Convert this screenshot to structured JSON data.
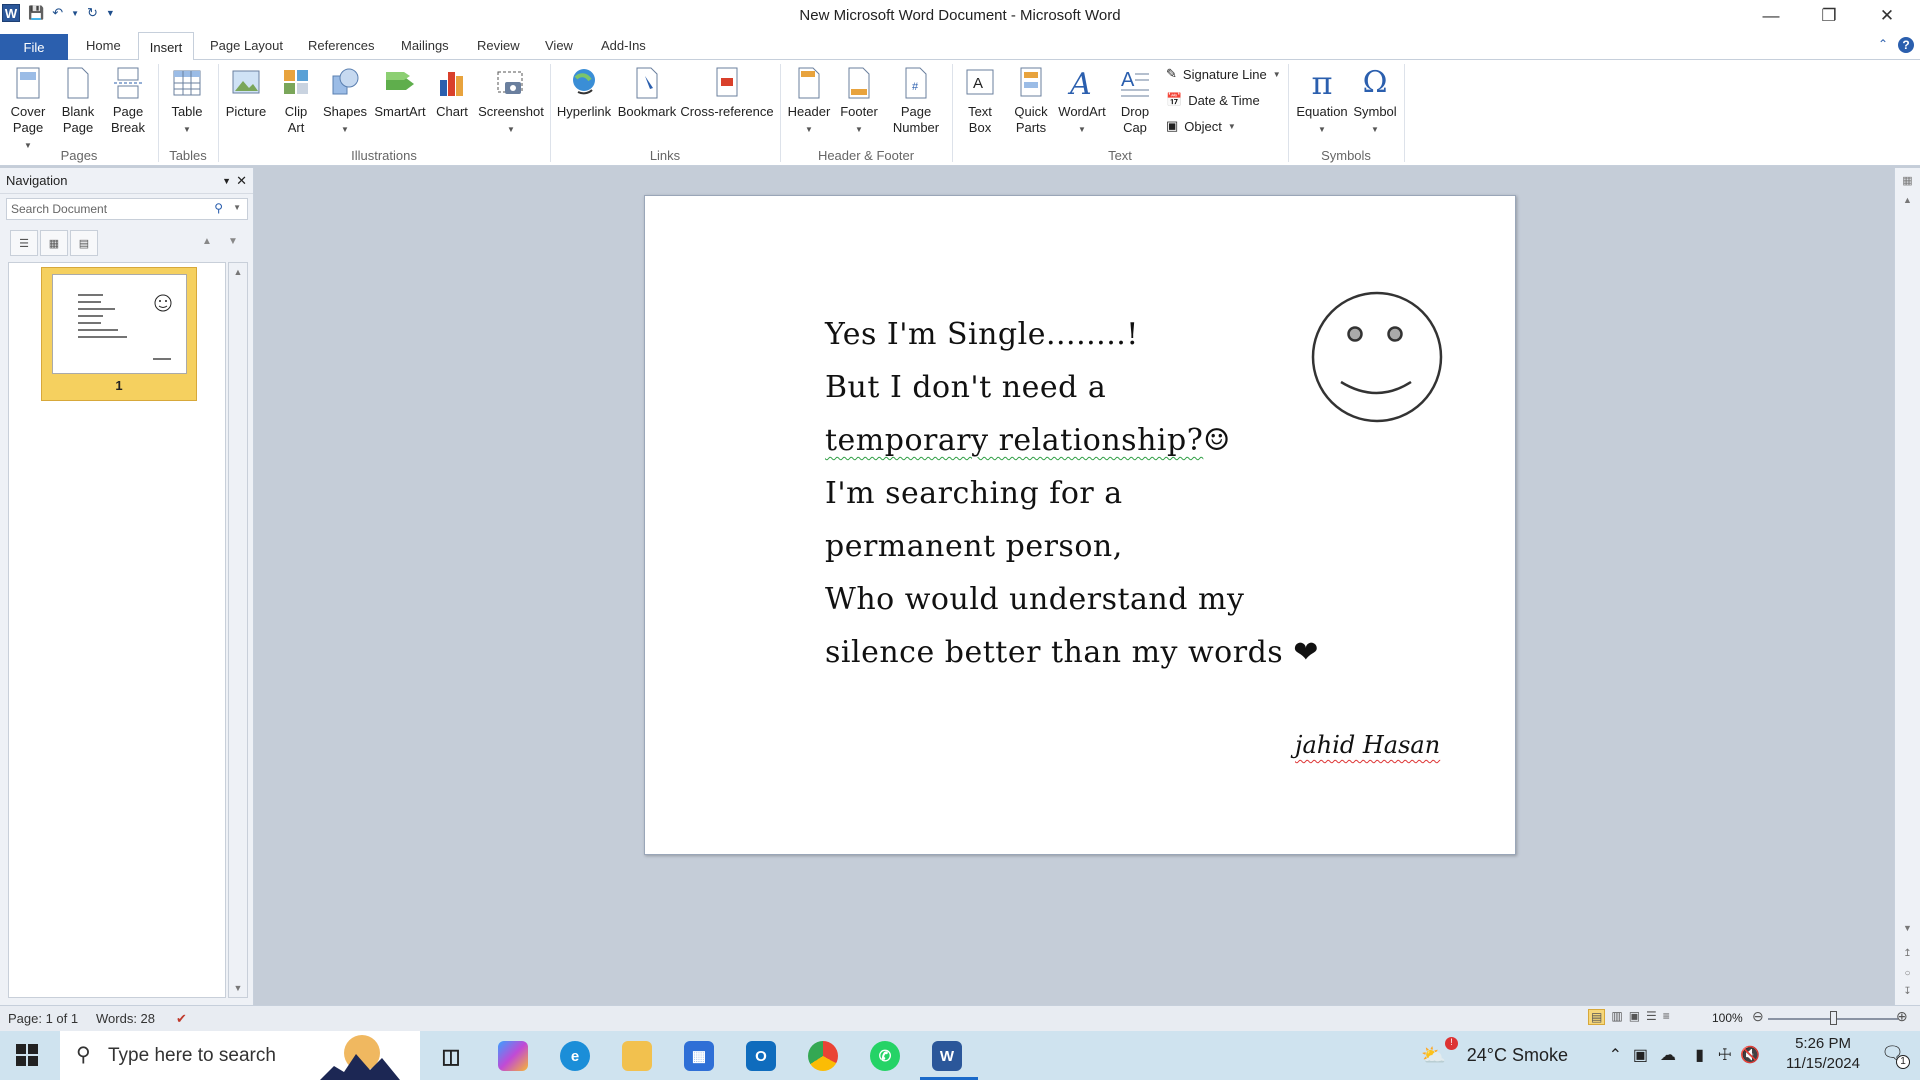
{
  "window": {
    "title": "New Microsoft Word Document  -  Microsoft Word",
    "app_icon_letter": "W"
  },
  "tabs": [
    "File",
    "Home",
    "Insert",
    "Page Layout",
    "References",
    "Mailings",
    "Review",
    "View",
    "Add-Ins"
  ],
  "ribbon": {
    "pages": {
      "label": "Pages",
      "cover": "Cover Page",
      "blank": "Blank Page",
      "break": "Page Break"
    },
    "tables": {
      "label": "Tables",
      "table": "Table"
    },
    "illustrations": {
      "label": "Illustrations",
      "picture": "Picture",
      "clipart": "Clip Art",
      "shapes": "Shapes",
      "smartart": "SmartArt",
      "chart": "Chart",
      "screenshot": "Screenshot"
    },
    "links": {
      "label": "Links",
      "hyperlink": "Hyperlink",
      "bookmark": "Bookmark",
      "crossref": "Cross-reference"
    },
    "headerfooter": {
      "label": "Header & Footer",
      "header": "Header",
      "footer": "Footer",
      "pagenumber": "Page Number"
    },
    "text": {
      "label": "Text",
      "textbox": "Text Box",
      "quickparts": "Quick Parts",
      "wordart": "WordArt",
      "dropcap": "Drop Cap",
      "signature": "Signature Line",
      "datetime": "Date & Time",
      "object": "Object"
    },
    "symbols": {
      "label": "Symbols",
      "equation": "Equation",
      "symbol": "Symbol"
    }
  },
  "nav": {
    "title": "Navigation",
    "search_placeholder": "Search Document",
    "page_number": "1"
  },
  "document": {
    "lines": [
      "Yes I'm Single........!",
      "But I don't need a",
      "temporary relationship?",
      "I'm searching for a",
      "permanent  person,",
      "Who would understand my",
      "silence better than my words"
    ],
    "smile_emoji": "☺",
    "heart": "❤",
    "signature": "jahid Hasan"
  },
  "status": {
    "page": "Page: 1 of 1",
    "words": "Words: 28",
    "zoom": "100%"
  },
  "taskbar": {
    "search_placeholder": "Type here to search",
    "weather": "24°C  Smoke",
    "time": "5:26 PM",
    "date": "11/15/2024",
    "notification_count": "1"
  }
}
